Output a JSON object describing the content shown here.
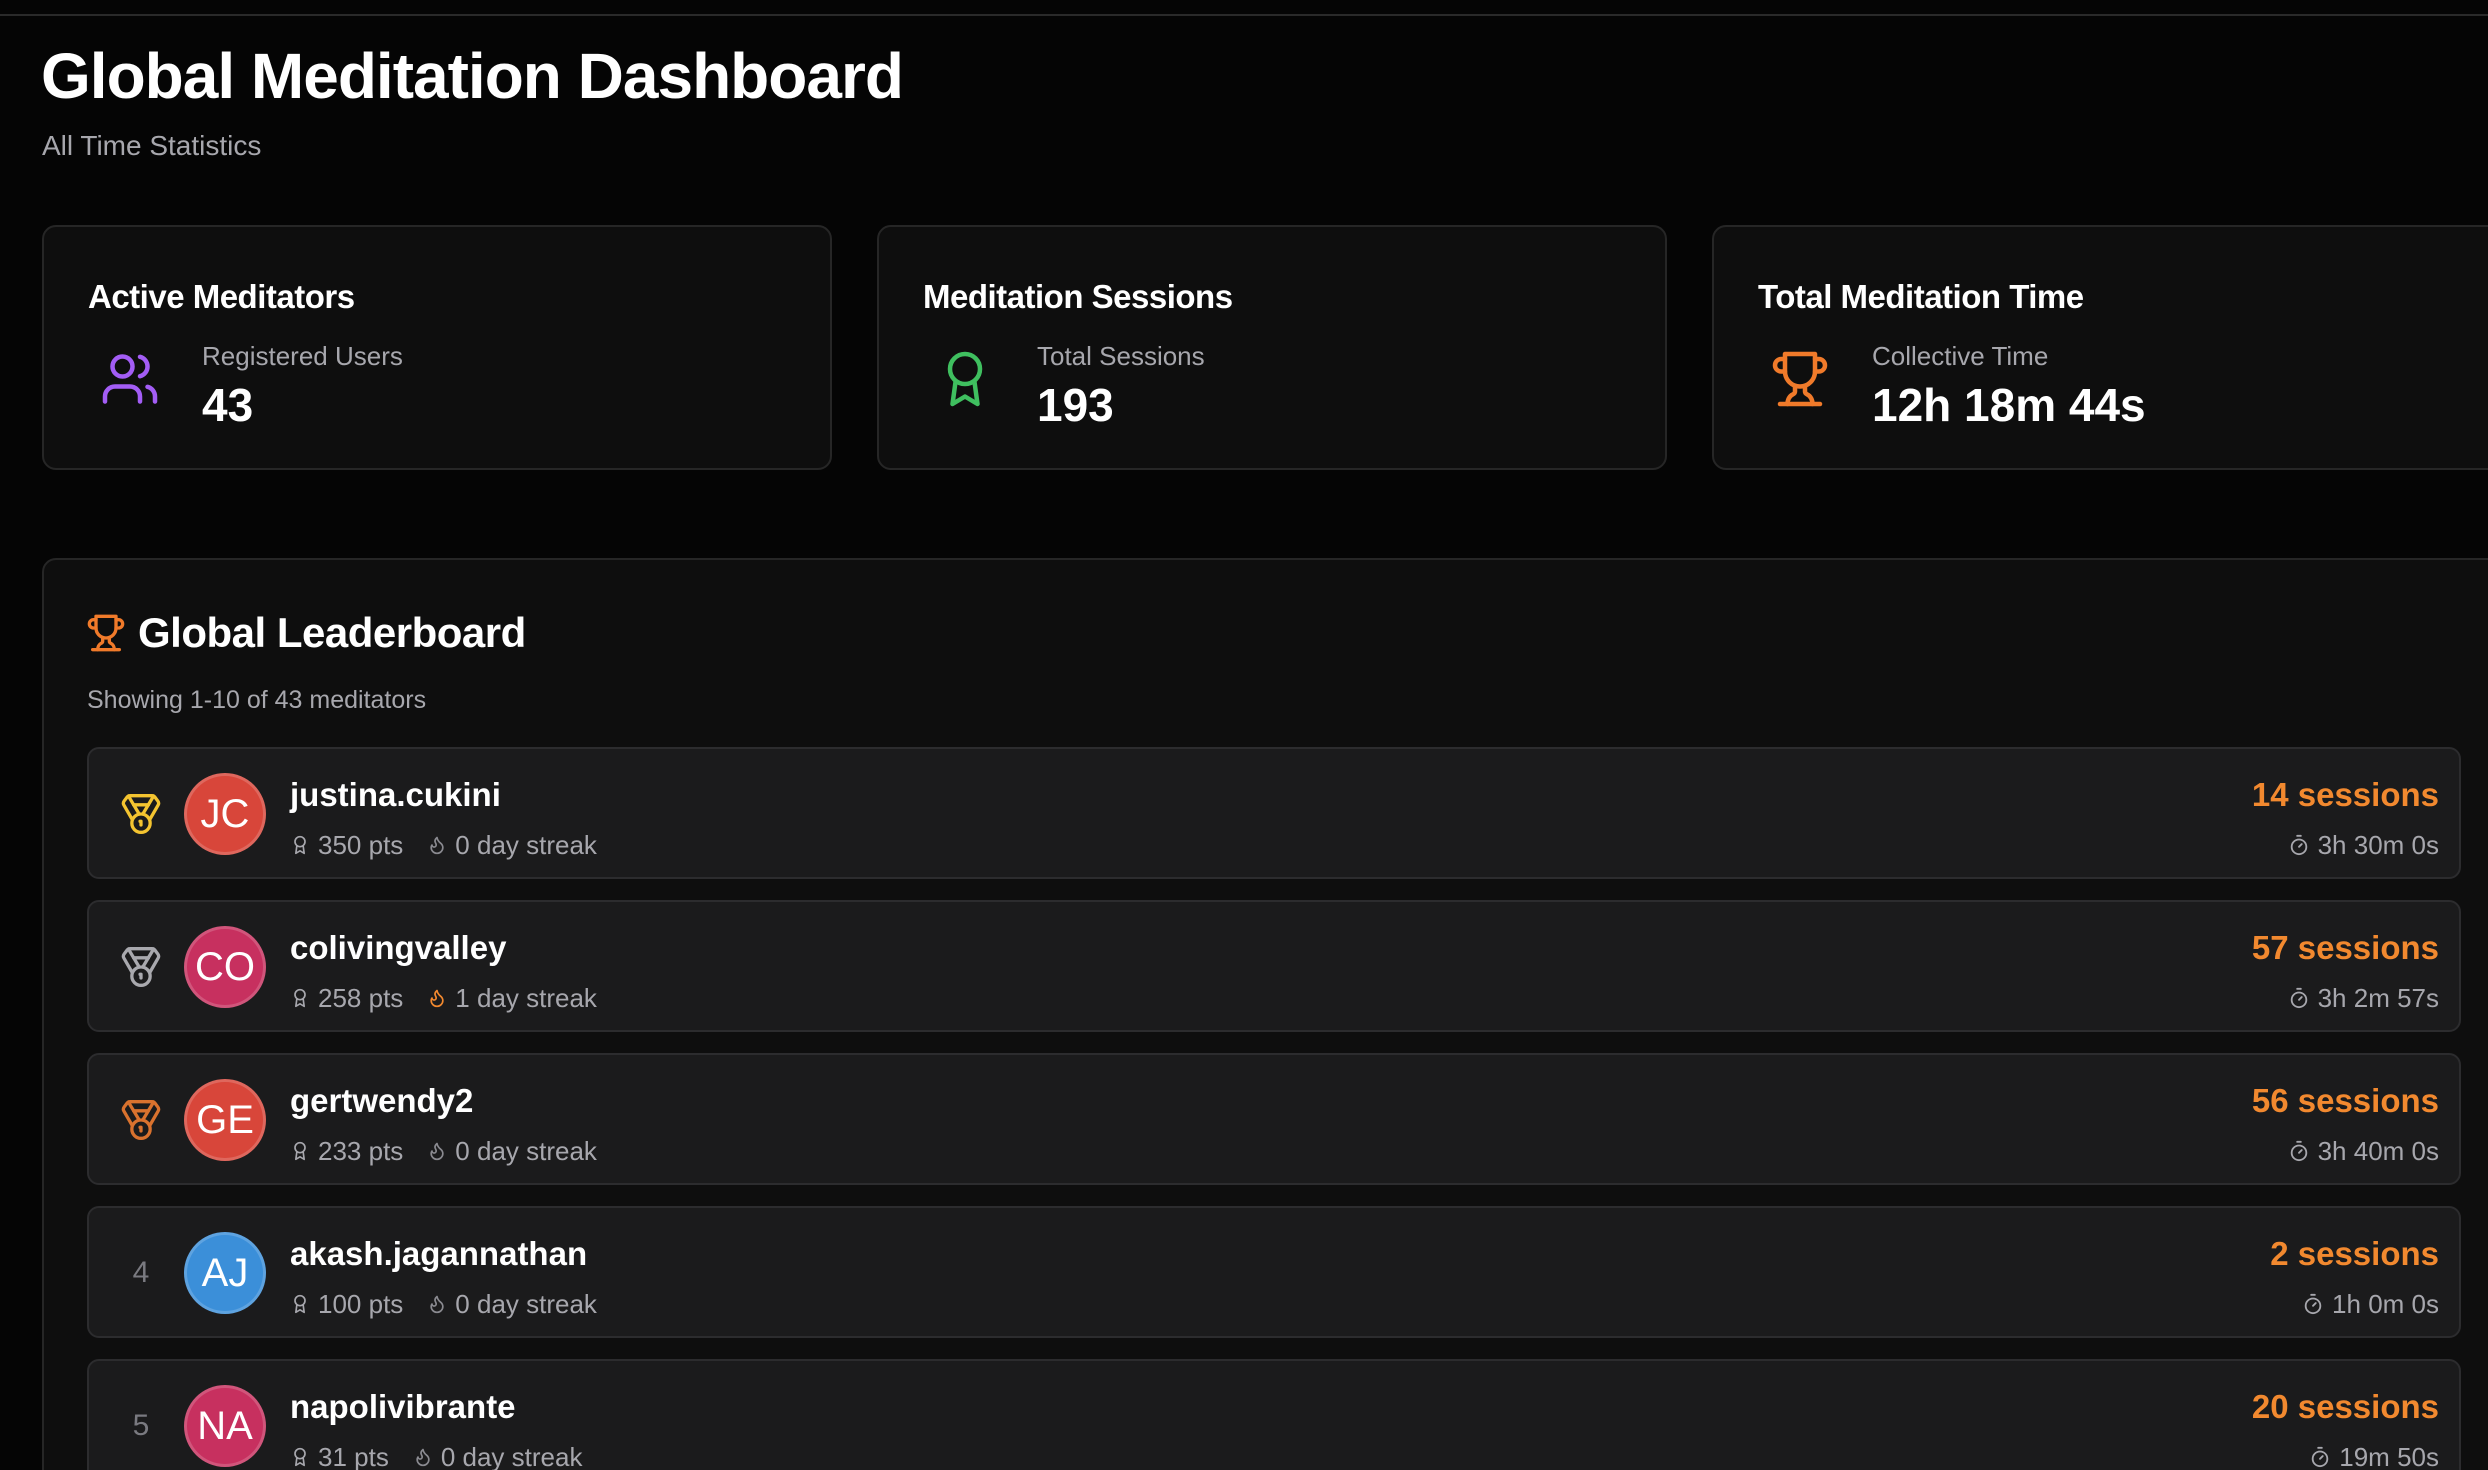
{
  "header": {
    "title": "Global Meditation Dashboard",
    "subtitle": "All Time Statistics"
  },
  "colors": {
    "background": "#050505",
    "card": "#0e0e0e",
    "row": "#1b1b1c",
    "accent_orange": "#f2892f",
    "users_icon": "#a35df5",
    "sessions_icon": "#3fbf5f",
    "trophy_icon": "#f07a2a",
    "gold": "#f4c430",
    "silver": "#a9a9ae",
    "bronze": "#d9722e"
  },
  "stats": [
    {
      "title": "Active Meditators",
      "label": "Registered Users",
      "value": "43",
      "icon": "users-icon"
    },
    {
      "title": "Meditation Sessions",
      "label": "Total Sessions",
      "value": "193",
      "icon": "award-ribbon-icon"
    },
    {
      "title": "Total Meditation Time",
      "label": "Collective Time",
      "value": "12h 18m 44s",
      "icon": "trophy-icon"
    }
  ],
  "leaderboard": {
    "title": "Global Leaderboard",
    "count_text": "Showing 1-10 of 43 meditators",
    "rows": [
      {
        "rank": "1",
        "rank_icon": "gold-medal-icon",
        "initials": "JC",
        "avatar_color": "#d8463a",
        "username": "justina.cukini",
        "points": "350 pts",
        "streak": "0 day streak",
        "streak_active": false,
        "sessions": "14 sessions",
        "duration": "3h 30m 0s"
      },
      {
        "rank": "2",
        "rank_icon": "silver-medal-icon",
        "initials": "CO",
        "avatar_color": "#c7305f",
        "username": "colivingvalley",
        "points": "258 pts",
        "streak": "1 day streak",
        "streak_active": true,
        "sessions": "57 sessions",
        "duration": "3h 2m 57s"
      },
      {
        "rank": "3",
        "rank_icon": "bronze-medal-icon",
        "initials": "GE",
        "avatar_color": "#d8463a",
        "username": "gertwendy2",
        "points": "233 pts",
        "streak": "0 day streak",
        "streak_active": false,
        "sessions": "56 sessions",
        "duration": "3h 40m 0s"
      },
      {
        "rank": "4",
        "rank_icon": "",
        "initials": "AJ",
        "avatar_color": "#3b8fd9",
        "username": "akash.jagannathan",
        "points": "100 pts",
        "streak": "0 day streak",
        "streak_active": false,
        "sessions": "2 sessions",
        "duration": "1h 0m 0s"
      },
      {
        "rank": "5",
        "rank_icon": "",
        "initials": "NA",
        "avatar_color": "#c7305f",
        "username": "napolivibrante",
        "points": "31 pts",
        "streak": "0 day streak",
        "streak_active": false,
        "sessions": "20 sessions",
        "duration": "19m 50s"
      }
    ]
  }
}
